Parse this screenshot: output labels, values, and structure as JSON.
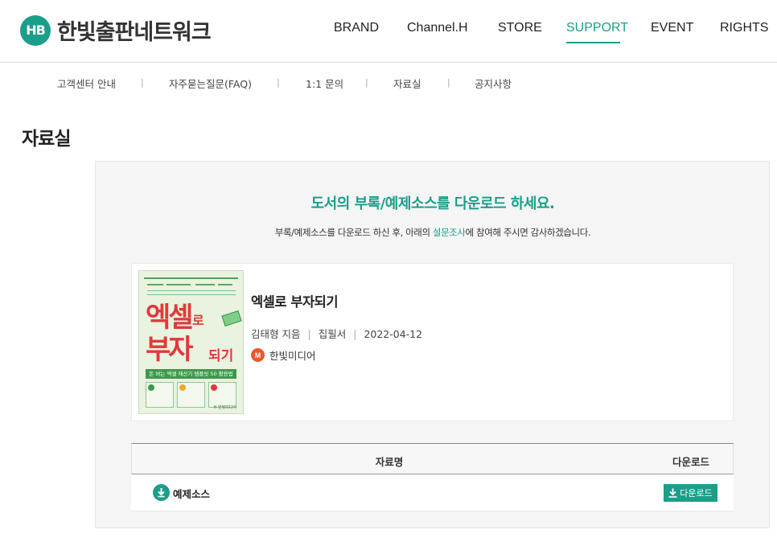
{
  "header": {
    "logo_mark": "HB",
    "logo_text": "한빛출판네트워크",
    "nav": [
      "BRAND",
      "Channel.H",
      "STORE",
      "SUPPORT",
      "EVENT",
      "RIGHTS"
    ],
    "active_nav": "SUPPORT"
  },
  "subnav": {
    "items": [
      "고객센터 안내",
      "자주묻는질문(FAQ)",
      "1:1 문의",
      "자료실",
      "공지사항"
    ],
    "separator": "|"
  },
  "page": {
    "title": "자료실",
    "headline": "도서의 부록/예제소스를 다운로드 하세요.",
    "subline_before": "부록/예제소스를 다운로드 하신 후, 아래의 ",
    "subline_link": "설문조사",
    "subline_after": "에 참여해 주시면 감사하겠습니다."
  },
  "book": {
    "title": "엑셀로 부자되기",
    "author": "김태형 지음",
    "type": "집필서",
    "date": "2022-04-12",
    "publisher": "한빛미디어",
    "publisher_badge": "M",
    "cover": {
      "title_line1": "엑셀",
      "title_line1_suffix": "로",
      "title_line2": "부자",
      "title_line2_suffix": "되기",
      "band_text": "돈 버는 엑셀 재산기 템플릿 50 활용법",
      "publisher": "H 한빛미디어",
      "step_numbers": [
        "1",
        "2",
        "3"
      ]
    }
  },
  "table": {
    "col_name": "자료명",
    "col_download": "다운로드",
    "rows": [
      {
        "name": "예제소스",
        "button": "다운로드"
      }
    ]
  },
  "colors": {
    "accent": "#1b9e8a",
    "cover_red": "#e0393b",
    "publisher_orange": "#e95a2a"
  }
}
